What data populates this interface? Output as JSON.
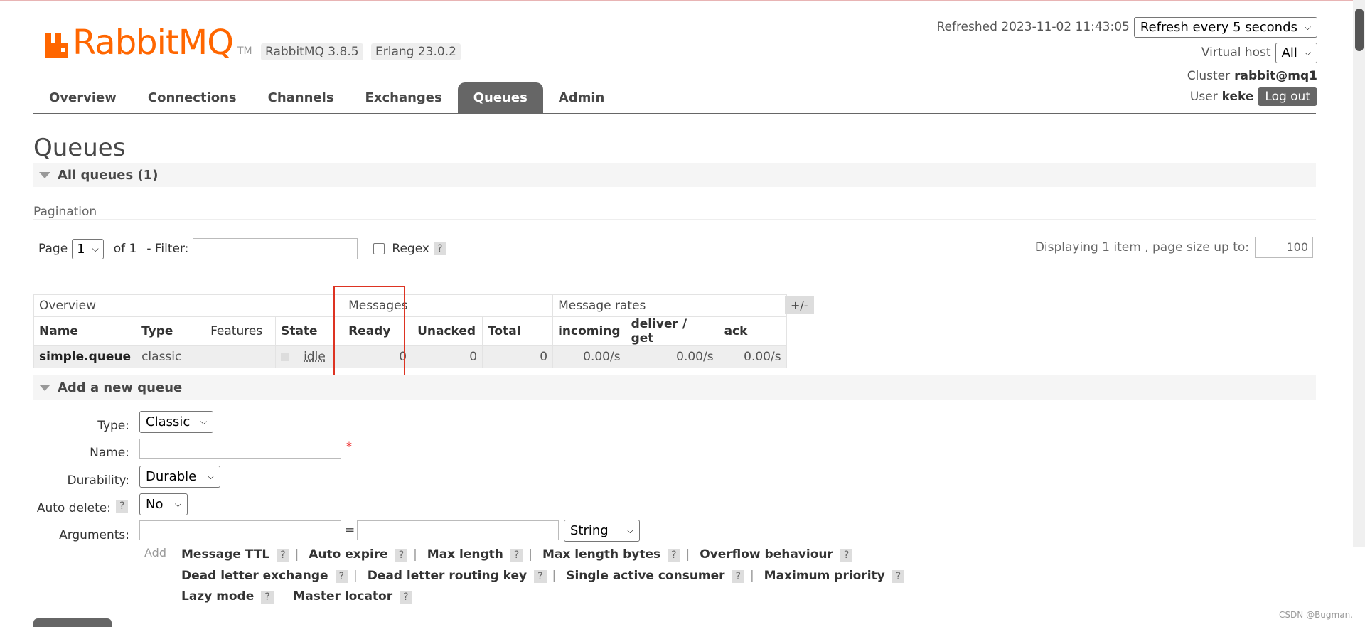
{
  "brand": {
    "name": "RabbitMQ",
    "tm": "TM",
    "version": "RabbitMQ 3.8.5",
    "erlang": "Erlang 23.0.2",
    "accent": "#ff6600"
  },
  "header": {
    "refreshed_label": "Refreshed 2023-11-02 11:43:05",
    "refresh_select": "Refresh every 5 seconds",
    "vhost_label": "Virtual host",
    "vhost_select": "All",
    "cluster_label": "Cluster",
    "cluster_value": "rabbit@mq1",
    "user_label": "User",
    "user_value": "keke",
    "logout": "Log out"
  },
  "tabs": [
    "Overview",
    "Connections",
    "Channels",
    "Exchanges",
    "Queues",
    "Admin"
  ],
  "active_tab": "Queues",
  "page_title": "Queues",
  "all_queues": "All queues (1)",
  "pagination": {
    "label": "Pagination",
    "page": "Page",
    "page_value": "1",
    "of": "of 1",
    "filter": "- Filter:",
    "regex": "Regex",
    "help": "?",
    "displaying": "Displaying 1 item , page size up to:",
    "page_size": "100"
  },
  "table": {
    "groups": [
      "Overview",
      "Messages",
      "Message rates"
    ],
    "columns": [
      "Name",
      "Type",
      "Features",
      "State",
      "Ready",
      "Unacked",
      "Total",
      "incoming",
      "deliver / get",
      "ack"
    ],
    "rows": [
      {
        "name": "simple.queue",
        "type": "classic",
        "features": "",
        "state": "idle",
        "ready": "0",
        "unacked": "0",
        "total": "0",
        "incoming": "0.00/s",
        "deliver": "0.00/s",
        "ack": "0.00/s"
      }
    ],
    "plusminus": "+/-"
  },
  "add_queue": {
    "title": "Add a new queue",
    "type_label": "Type:",
    "type_value": "Classic",
    "name_label": "Name:",
    "required": "*",
    "durability_label": "Durability:",
    "durability_value": "Durable",
    "auto_delete_label": "Auto delete:",
    "auto_delete_value": "No",
    "arguments_label": "Arguments:",
    "equals": "=",
    "arg_type": "String",
    "add": "Add",
    "arg_links": [
      [
        "Message TTL",
        "Auto expire",
        "Max length",
        "Max length bytes",
        "Overflow behaviour"
      ],
      [
        "Dead letter exchange",
        "Dead letter routing key",
        "Single active consumer",
        "Maximum priority"
      ],
      [
        "Lazy mode",
        "Master locator"
      ]
    ]
  },
  "watermark": "CSDN @Bugman."
}
